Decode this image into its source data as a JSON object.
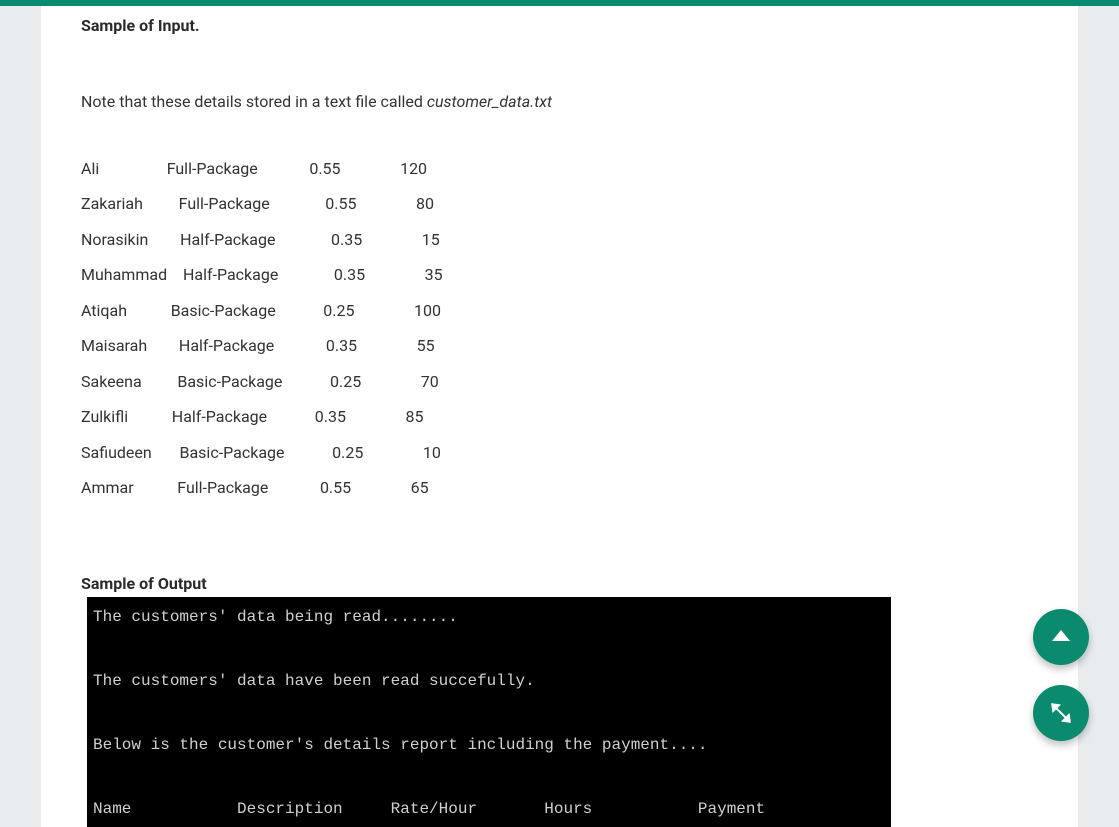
{
  "heading1": "Sample of Input.",
  "note_prefix": "Note that these details stored in a text file called ",
  "note_filename": "customer_data.txt",
  "input_rows": [
    "Ali                 Full-Package             0.55               120",
    "Zakariah         Full-Package              0.55               80",
    "Norasikin        Half-Package              0.35               15",
    "Muhammad    Half-Package              0.35               35",
    "Atiqah           Basic-Package            0.25               100",
    "Maisarah        Half-Package             0.35               55",
    "Sakeena         Basic-Package            0.25               70",
    "Zulkifli           Half-Package            0.35               85",
    "Safiudeen       Basic-Package            0.25               10",
    "Ammar           Full-Package             0.55               65"
  ],
  "heading2": "Sample of Output",
  "console_lines": [
    "The customers' data being read........",
    "",
    "The customers' data have been read succefully.",
    "",
    "Below is the customer's details report including the payment....",
    "",
    "Name           Description     Rate/Hour       Hours           Payment"
  ]
}
